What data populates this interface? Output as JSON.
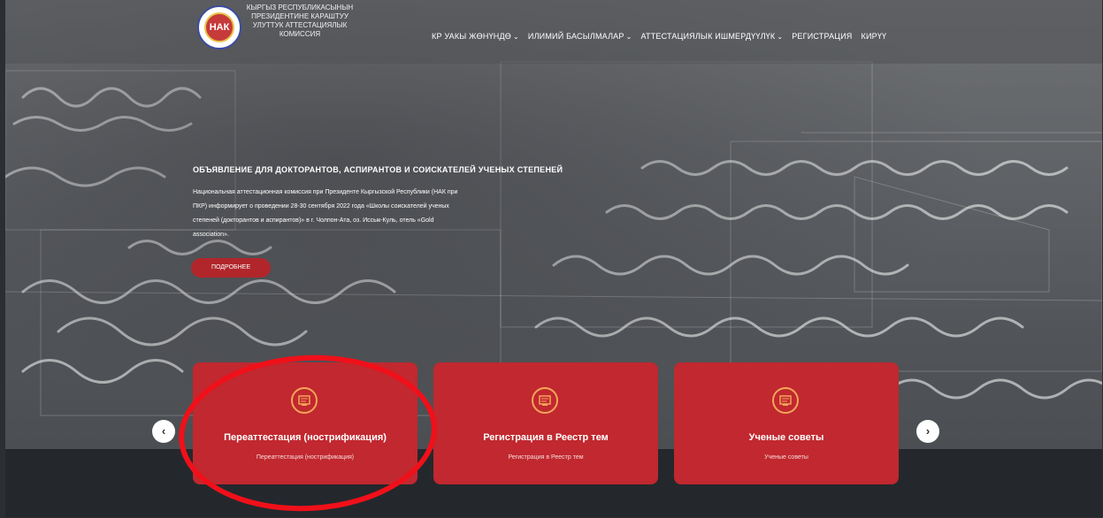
{
  "header": {
    "logo_lines": [
      "КЫРГЫЗ РЕСПУБЛИКАСЫНЫН",
      "ПРЕЗИДЕНТИНЕ КАРАШТУУ",
      "УЛУТТУК АТТЕСТАЦИЯЛЫК",
      "КОМИССИЯ"
    ],
    "logo_mark": "НАК",
    "nav": [
      {
        "label": "КР УАКЫ ЖӨНҮНДӨ",
        "has_dropdown": true
      },
      {
        "label": "ИЛИМИЙ БАСЫЛМАЛАР",
        "has_dropdown": true
      },
      {
        "label": "АТТЕСТАЦИЯЛЫК ИШМЕРДҮҮЛҮК",
        "has_dropdown": true
      },
      {
        "label": "РЕГИСТРАЦИЯ",
        "has_dropdown": false
      },
      {
        "label": "КИРҮҮ",
        "has_dropdown": false
      }
    ]
  },
  "announcement": {
    "title": "ОБЪЯВЛЕНИЕ ДЛЯ ДОКТОРАНТОВ, АСПИРАНТОВ И СОИСКАТЕЛЕЙ УЧЕНЫХ СТЕПЕНЕЙ",
    "body": "Национальная аттестационная комиссия при Президенте Кыргызской Республики (НАК при ПКР) информирует о проведении 28-30 сентября 2022 года «Школы соискателей ученых степеней (докторантов и аспирантов)» в г. Чолпон-Ата, оз. Иссык-Куль, отель «Gold association».",
    "button_label": "ПОДРОБНЕЕ"
  },
  "cards": [
    {
      "title": "Переаттестация (нострификация)",
      "subtitle": "Переаттестация (нострификация)"
    },
    {
      "title": "Регистрация в Реестр тем",
      "subtitle": "Регистрация в Реестр тем"
    },
    {
      "title": "Ученые советы",
      "subtitle": "Ученые советы"
    }
  ],
  "carousel": {
    "prev_symbol": "‹",
    "next_symbol": "›"
  },
  "colors": {
    "card_red": "#c1282f",
    "button_red": "#b1262b",
    "highlight_red": "#f0101a",
    "icon_orange": "#f2a65a"
  }
}
